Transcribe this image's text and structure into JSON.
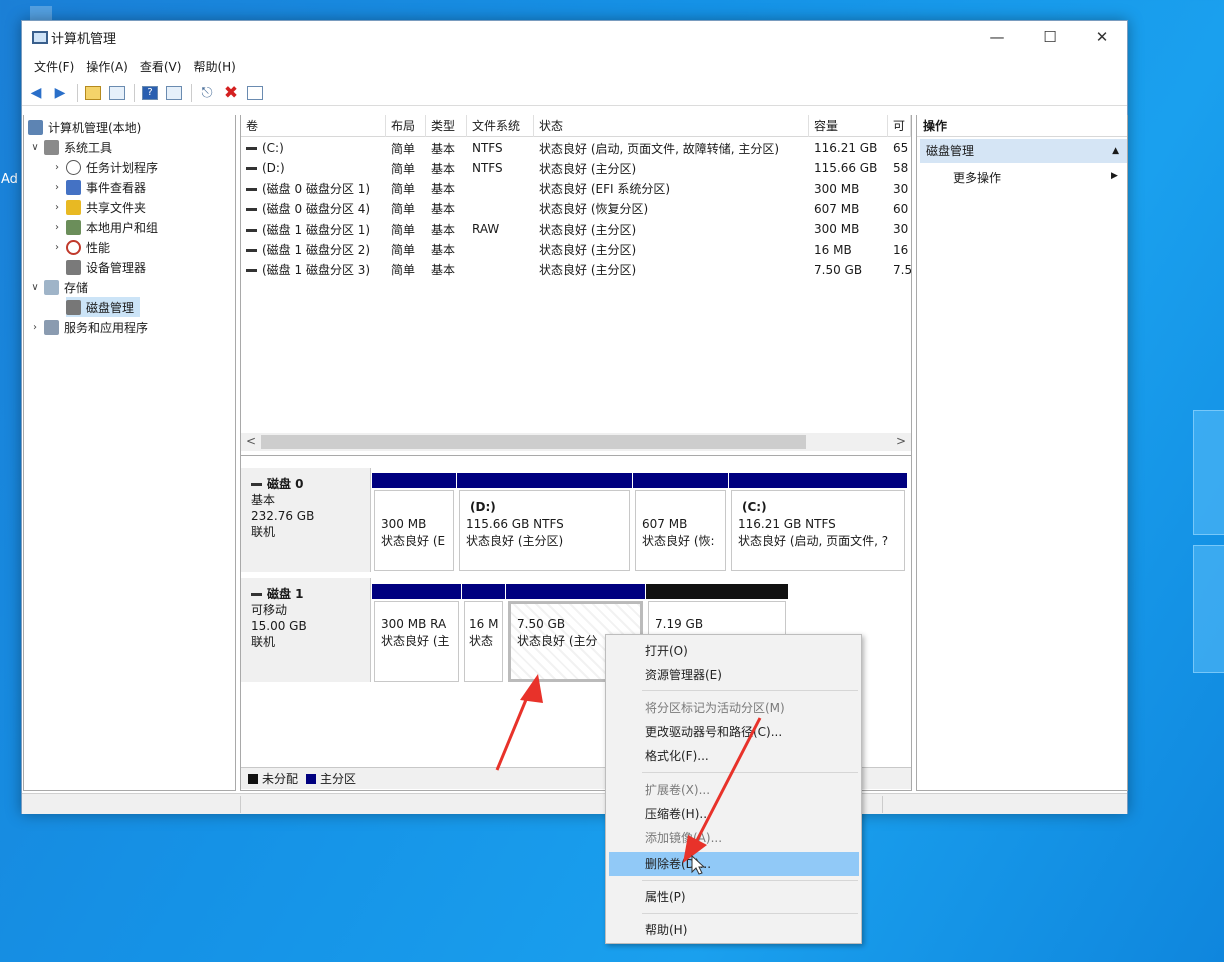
{
  "desktop": {
    "side_text": "Ad"
  },
  "window": {
    "title": "计算机管理",
    "caption": {
      "minimize": "—",
      "maximize": "☐",
      "close": "✕"
    }
  },
  "menu": [
    "文件(F)",
    "操作(A)",
    "查看(V)",
    "帮助(H)"
  ],
  "tree": {
    "root": "计算机管理(本地)",
    "system_tools": "系统工具",
    "task_scheduler": "任务计划程序",
    "event_viewer": "事件查看器",
    "shared_folders": "共享文件夹",
    "local_users": "本地用户和组",
    "performance": "性能",
    "device_manager": "设备管理器",
    "storage": "存储",
    "disk_management": "磁盘管理",
    "services": "服务和应用程序"
  },
  "volume_list": {
    "columns": [
      "卷",
      "布局",
      "类型",
      "文件系统",
      "状态",
      "容量",
      "可"
    ],
    "rows": [
      {
        "vol": "(C:)",
        "layout": "简单",
        "type": "基本",
        "fs": "NTFS",
        "status": "状态良好 (启动, 页面文件, 故障转储, 主分区)",
        "cap": "116.21 GB",
        "free": "65"
      },
      {
        "vol": "(D:)",
        "layout": "简单",
        "type": "基本",
        "fs": "NTFS",
        "status": "状态良好 (主分区)",
        "cap": "115.66 GB",
        "free": "58"
      },
      {
        "vol": "(磁盘 0 磁盘分区 1)",
        "layout": "简单",
        "type": "基本",
        "fs": "",
        "status": "状态良好 (EFI 系统分区)",
        "cap": "300 MB",
        "free": "30"
      },
      {
        "vol": "(磁盘 0 磁盘分区 4)",
        "layout": "简单",
        "type": "基本",
        "fs": "",
        "status": "状态良好 (恢复分区)",
        "cap": "607 MB",
        "free": "60"
      },
      {
        "vol": "(磁盘 1 磁盘分区 1)",
        "layout": "简单",
        "type": "基本",
        "fs": "RAW",
        "status": "状态良好 (主分区)",
        "cap": "300 MB",
        "free": "30"
      },
      {
        "vol": "(磁盘 1 磁盘分区 2)",
        "layout": "简单",
        "type": "基本",
        "fs": "",
        "status": "状态良好 (主分区)",
        "cap": "16 MB",
        "free": "16"
      },
      {
        "vol": "(磁盘 1 磁盘分区 3)",
        "layout": "简单",
        "type": "基本",
        "fs": "",
        "status": "状态良好 (主分区)",
        "cap": "7.50 GB",
        "free": "7.5"
      }
    ],
    "scroll_left": "<",
    "scroll_right": ">"
  },
  "disk0": {
    "name": "磁盘 0",
    "type": "基本",
    "size": "232.76 GB",
    "state": "联机",
    "parts": [
      {
        "title": "",
        "line1": "300 MB",
        "line2": "状态良好 (E"
      },
      {
        "title": "(D:)",
        "line1": "115.66 GB NTFS",
        "line2": "状态良好 (主分区)"
      },
      {
        "title": "",
        "line1": "607 MB",
        "line2": "状态良好 (恢:"
      },
      {
        "title": "(C:)",
        "line1": "116.21 GB NTFS",
        "line2": "状态良好 (启动, 页面文件, ?"
      }
    ]
  },
  "disk1": {
    "name": "磁盘 1",
    "type": "可移动",
    "size": "15.00 GB",
    "state": "联机",
    "parts": [
      {
        "line1": "300 MB RA",
        "line2": "状态良好 (主"
      },
      {
        "line1": "16 M",
        "line2": "状态"
      },
      {
        "line1": "7.50 GB",
        "line2": "状态良好 (主分"
      },
      {
        "line1": "7.19 GB",
        "line2": ""
      }
    ]
  },
  "legend": {
    "unallocated": "未分配",
    "primary": "主分区"
  },
  "actions": {
    "header": "操作",
    "section": "磁盘管理",
    "more": "更多操作"
  },
  "context_menu": {
    "open": "打开(O)",
    "explorer": "资源管理器(E)",
    "mark_active": "将分区标记为活动分区(M)",
    "change_letter": "更改驱动器号和路径(C)...",
    "format": "格式化(F)...",
    "extend": "扩展卷(X)...",
    "shrink": "压缩卷(H)...",
    "add_mirror": "添加镜像(A)...",
    "delete": "删除卷(D)...",
    "properties": "属性(P)",
    "help": "帮助(H)"
  },
  "colors": {
    "primary_partition": "#00007f",
    "unallocated": "#111111",
    "highlight": "#91c9f7",
    "annotation_arrow": "#e8322a"
  }
}
